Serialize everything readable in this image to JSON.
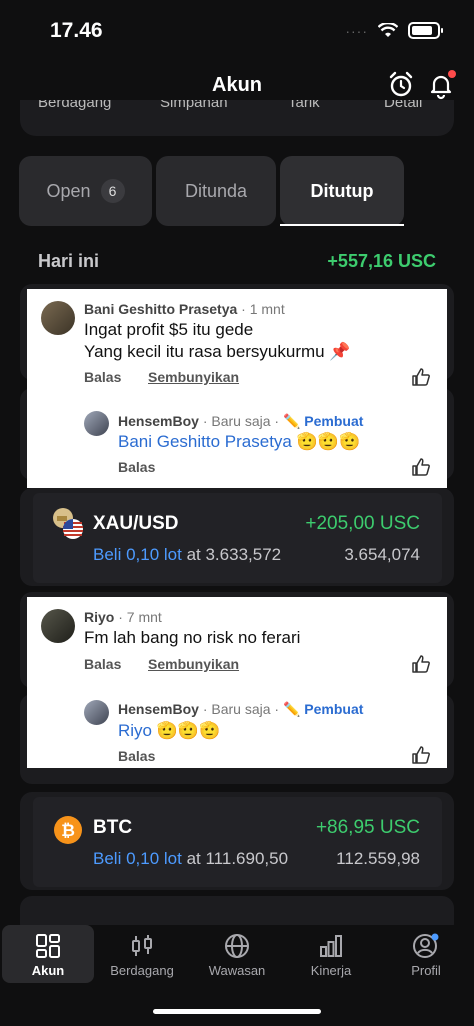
{
  "status": {
    "time": "17.46",
    "signal": "····"
  },
  "header": {
    "title": "Akun"
  },
  "actions": {
    "items": [
      "Berdagang",
      "Simpanan",
      "Tarik",
      "Detail"
    ]
  },
  "tabs": [
    {
      "label": "Open",
      "count": "6"
    },
    {
      "label": "Ditunda"
    },
    {
      "label": "Ditutup"
    }
  ],
  "today": {
    "label": "Hari ini",
    "total": "+557,16 USC"
  },
  "comment1": {
    "author": "Bani Geshitto Prasetya",
    "time": "· 1 mnt",
    "line1": "Ingat profit $5 itu gede",
    "line2": "Yang kecil itu rasa bersyukurmu 📌",
    "reply_label": "Balas",
    "hide_label": "Sembunyikan",
    "reply": {
      "author": "HensemBoy",
      "time": "· Baru saja ·",
      "creator": "✏️ Pembuat",
      "mention": "Bani Geshitto Prasetya",
      "emoji": "🫡🫡🫡",
      "reply_label": "Balas"
    }
  },
  "trade_xau": {
    "symbol": "XAU/USD",
    "profit": "+205,00 USC",
    "side": "Beli 0,10 lot",
    "open_price": "at 3.633,572",
    "current_price": "3.654,074"
  },
  "comment2": {
    "author": "Riyo",
    "time": "· 7 mnt",
    "line1": "Fm lah bang no risk no ferari",
    "reply_label": "Balas",
    "hide_label": "Sembunyikan",
    "reply": {
      "author": "HensemBoy",
      "time": "· Baru saja ·",
      "creator": "✏️ Pembuat",
      "mention": "Riyo",
      "emoji": "🫡🫡🫡",
      "reply_label": "Balas"
    }
  },
  "trade_btc": {
    "symbol": "BTC",
    "profit": "+86,95 USC",
    "side": "Beli 0,10 lot",
    "open_price": "at 111.690,50",
    "current_price": "112.559,98"
  },
  "nav": [
    {
      "label": "Akun"
    },
    {
      "label": "Berdagang"
    },
    {
      "label": "Wawasan"
    },
    {
      "label": "Kinerja"
    },
    {
      "label": "Profil"
    }
  ],
  "colors": {
    "profit": "#3dcc6e",
    "buy": "#4d9bff",
    "creator": "#2b6cd1",
    "notification": "#ff4b4b"
  }
}
